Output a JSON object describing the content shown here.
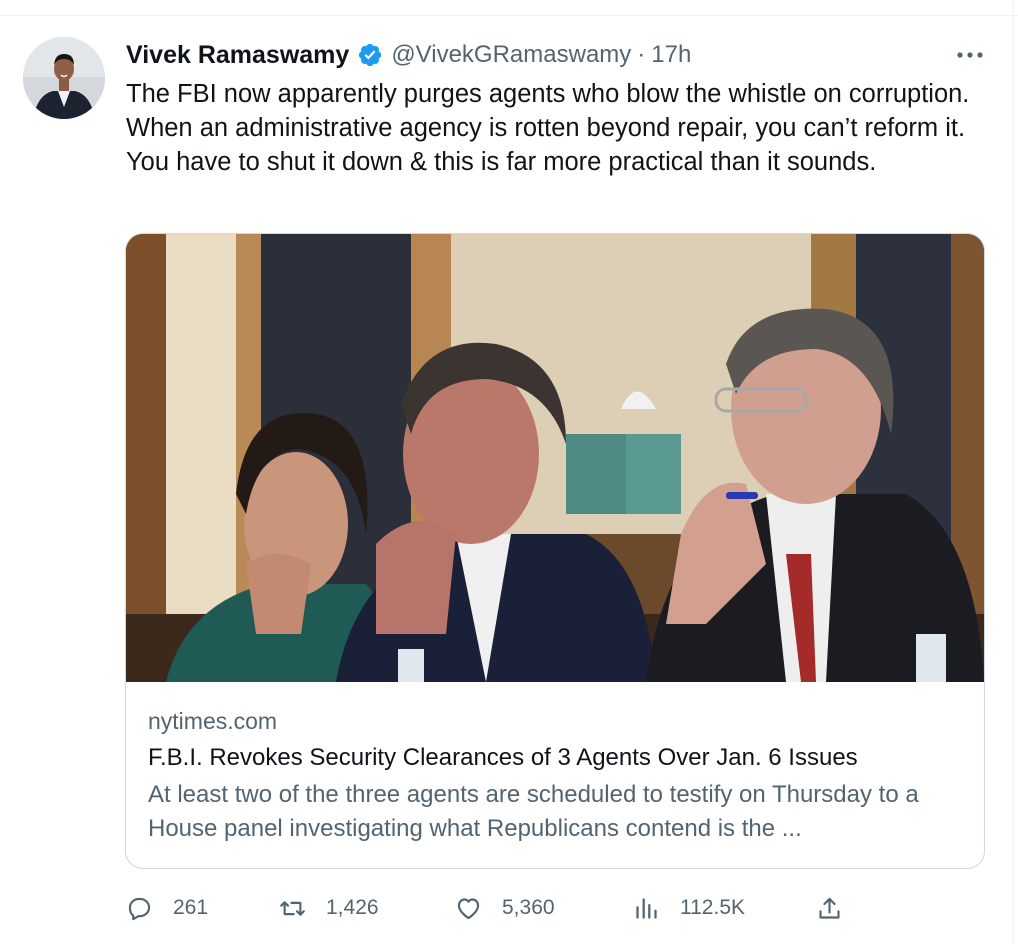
{
  "tweet": {
    "author_name": "Vivek Ramaswamy",
    "handle": "@VivekGRamaswamy",
    "separator": "·",
    "time": "17h",
    "text": "The FBI now apparently purges agents who blow the whistle on corruption. When an administrative agency is rotten beyond repair, you can’t reform it. You have to shut it down & this is far more practical than it sounds."
  },
  "card": {
    "domain": "nytimes.com",
    "title": "F.B.I. Revokes Security Clearances of 3 Agents Over Jan. 6 Issues",
    "description": "At least two of the three agents are scheduled to testify on Thursday to a House panel investigating what Republicans contend is the ..."
  },
  "actions": {
    "replies": "261",
    "retweets": "1,426",
    "likes": "5,360",
    "views": "112.5K"
  },
  "icons": {
    "verified": "verified-badge-icon",
    "more": "more-options-icon",
    "reply": "reply-icon",
    "retweet": "retweet-icon",
    "like": "heart-icon",
    "views": "views-chart-icon",
    "share": "share-icon"
  },
  "colors": {
    "verified_blue": "#1d9bf0",
    "secondary_text": "#536471",
    "primary_text": "#0f1419",
    "border": "#cfd9de"
  }
}
